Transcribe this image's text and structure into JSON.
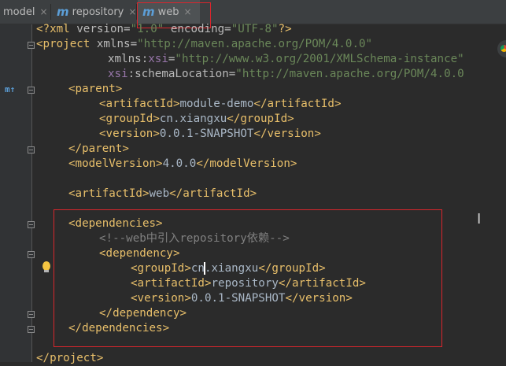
{
  "tabs": [
    {
      "icon": "m",
      "label": "model",
      "active": false
    },
    {
      "icon": "m",
      "label": "repository",
      "active": false
    },
    {
      "icon": "m",
      "label": "web",
      "active": true
    }
  ],
  "close_glyph": "×",
  "colors": {
    "background": "#2b2b2b",
    "tag": "#e8bf6a",
    "string": "#6a8759",
    "comment": "#808080",
    "text": "#a9b7c6",
    "annotation_box": "#d9262d"
  },
  "code": {
    "l1": {
      "a": "<?xml ",
      "b": "version=",
      "c": "\"1.0\"",
      "d": " encoding=",
      "e": "\"UTF-8\"",
      "f": "?>"
    },
    "l2": {
      "a": "<project ",
      "b": "xmlns=",
      "c": "\"http://maven.apache.org/POM/4.0.0\""
    },
    "l3": {
      "a": "xmlns:",
      "b": "xsi",
      "c": "=",
      "d": "\"http://www.w3.org/2001/XMLSchema-instance\""
    },
    "l4": {
      "a": "xsi",
      "b": ":schemaLocation=",
      "c": "\"http://maven.apache.org/POM/4.0.0"
    },
    "l5": "<parent>",
    "l6": {
      "a": "<artifactId>",
      "b": "module-demo",
      "c": "</artifactId>"
    },
    "l7": {
      "a": "<groupId>",
      "b": "cn.xiangxu",
      "c": "</groupId>"
    },
    "l8": {
      "a": "<version>",
      "b": "0.0.1-SNAPSHOT",
      "c": "</version>"
    },
    "l9": "</parent>",
    "l10": {
      "a": "<modelVersion>",
      "b": "4.0.0",
      "c": "</modelVersion>"
    },
    "l12": {
      "a": "<artifactId>",
      "b": "web",
      "c": "</artifactId>"
    },
    "l14": "<dependencies>",
    "l15": "<!--web中引入repository依赖-->",
    "l16": "<dependency>",
    "l17": {
      "a": "<groupId>",
      "b1": "cn",
      "b2": ".xiangxu",
      "c": "</groupId>"
    },
    "l18": {
      "a": "<artifactId>",
      "b": "repository",
      "c": "</artifactId>"
    },
    "l19": {
      "a": "<version>",
      "b": "0.0.1-SNAPSHOT",
      "c": "</version>"
    },
    "l20": "</dependency>",
    "l21": "</dependencies>",
    "l23": "</project>"
  }
}
